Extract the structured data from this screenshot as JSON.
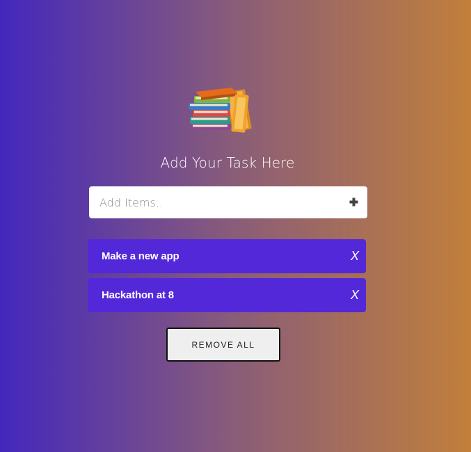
{
  "header": {
    "logo_icon": "books-stack-icon",
    "title": "Add Your Task Here"
  },
  "add_form": {
    "placeholder": "Add Items..",
    "value": "",
    "add_icon": "plus-icon"
  },
  "tasks": [
    {
      "label": "Make a new app",
      "remove_label": "X"
    },
    {
      "label": "Hackathon at 8",
      "remove_label": "X"
    }
  ],
  "actions": {
    "remove_all_label": "REMOVE ALL"
  },
  "colors": {
    "gradient_start": "#4327bd",
    "gradient_end": "#c17f3b",
    "task_bg": "#5328d8"
  }
}
